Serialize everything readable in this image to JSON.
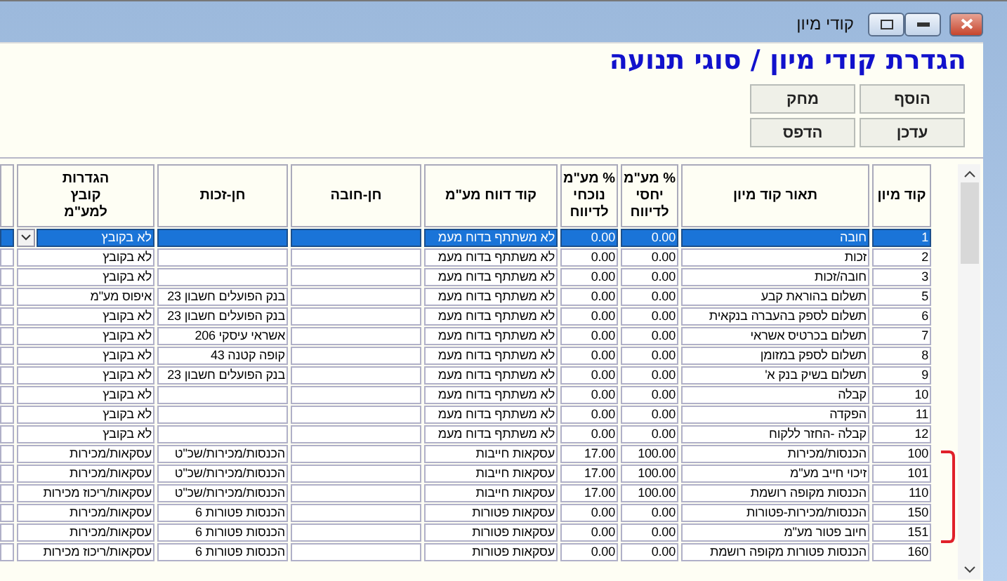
{
  "window": {
    "title": "קודי מיון"
  },
  "heading": "הגדרת קודי מיון / סוגי תנועה",
  "buttons": [
    {
      "label": "הוסף"
    },
    {
      "label": "מחק"
    },
    {
      "label": "עדכן"
    },
    {
      "label": "הדפס"
    }
  ],
  "table": {
    "columns": [
      "קוד מיון",
      "תאור קוד מיון",
      "% מע\"מ\nיחסי\nלדיווח",
      "% מע\"מ\nנוכחי\nלדיווח",
      "קוד דווח מע\"מ",
      "חן-חובה",
      "חן-זכות",
      "הגדרות\nקובץ\nלמע\"מ"
    ],
    "rows": [
      {
        "selected": true,
        "cells": [
          "1",
          "חובה",
          "0.00",
          "0.00",
          "לא משתתף בדוח מעמ",
          "",
          "",
          "לא בקובץ"
        ]
      },
      {
        "selected": false,
        "cells": [
          "2",
          "זכות",
          "0.00",
          "0.00",
          "לא משתתף בדוח מעמ",
          "",
          "",
          "לא בקובץ"
        ]
      },
      {
        "selected": false,
        "cells": [
          "3",
          "חובה/זכות",
          "0.00",
          "0.00",
          "לא משתתף בדוח מעמ",
          "",
          "",
          "לא בקובץ"
        ]
      },
      {
        "selected": false,
        "cells": [
          "5",
          "תשלום בהוראת קבע",
          "0.00",
          "0.00",
          "לא משתתף בדוח מעמ",
          "",
          "בנק הפועלים חשבון 23",
          "איפוס מע\"מ"
        ]
      },
      {
        "selected": false,
        "cells": [
          "6",
          "תשלום לספק בהעברה בנקאית",
          "0.00",
          "0.00",
          "לא משתתף בדוח מעמ",
          "",
          "בנק הפועלים חשבון 23",
          "לא בקובץ"
        ]
      },
      {
        "selected": false,
        "cells": [
          "7",
          "תשלום בכרטיס אשראי",
          "0.00",
          "0.00",
          "לא משתתף בדוח מעמ",
          "",
          "אשראי עיסקי  206",
          "לא בקובץ"
        ]
      },
      {
        "selected": false,
        "cells": [
          "8",
          "תשלום לספק במזומן",
          "0.00",
          "0.00",
          "לא משתתף בדוח מעמ",
          "",
          "קופה קטנה  43",
          "לא בקובץ"
        ]
      },
      {
        "selected": false,
        "cells": [
          "9",
          "תשלום בשיק בנק א'",
          "0.00",
          "0.00",
          "לא משתתף בדוח מעמ",
          "",
          "בנק הפועלים חשבון 23",
          "לא בקובץ"
        ]
      },
      {
        "selected": false,
        "cells": [
          "10",
          "קבלה",
          "0.00",
          "0.00",
          "לא משתתף בדוח מעמ",
          "",
          "",
          "לא בקובץ"
        ]
      },
      {
        "selected": false,
        "cells": [
          "11",
          "הפקדה",
          "0.00",
          "0.00",
          "לא משתתף בדוח מעמ",
          "",
          "",
          "לא בקובץ"
        ]
      },
      {
        "selected": false,
        "cells": [
          "12",
          "קבלה -החזר ללקוח",
          "0.00",
          "0.00",
          "לא משתתף בדוח מעמ",
          "",
          "",
          "לא בקובץ"
        ]
      },
      {
        "selected": false,
        "cells": [
          "100",
          "הכנסות/מכירות",
          "100.00",
          "17.00",
          "עסקאות חייבות",
          "",
          "הכנסות/מכירות/שכ\"ט",
          "עסקאות/מכירות"
        ]
      },
      {
        "selected": false,
        "cells": [
          "101",
          "זיכוי חייב מע\"מ",
          "100.00",
          "17.00",
          "עסקאות חייבות",
          "",
          "הכנסות/מכירות/שכ\"ט",
          "עסקאות/מכירות"
        ]
      },
      {
        "selected": false,
        "cells": [
          "110",
          "הכנסות מקופה רושמת",
          "100.00",
          "17.00",
          "עסקאות חייבות",
          "",
          "הכנסות/מכירות/שכ\"ט",
          "עסקאות/ריכוז מכירות"
        ]
      },
      {
        "selected": false,
        "cells": [
          "150",
          "הכנסות/מכירות-פטורות",
          "0.00",
          "0.00",
          "עסקאות פטורות",
          "",
          "הכנסות פטורות  6",
          "עסקאות/מכירות"
        ]
      },
      {
        "selected": false,
        "cells": [
          "151",
          "חיוב פטור מע\"מ",
          "0.00",
          "0.00",
          "עסקאות פטורות",
          "",
          "הכנסות פטורות  6",
          "עסקאות/מכירות"
        ]
      },
      {
        "selected": false,
        "cells": [
          "160",
          "הכנסות פטורות מקופה רושמת",
          "0.00",
          "0.00",
          "עסקאות פטורות",
          "",
          "הכנסות פטורות  6",
          "עסקאות/ריכוז מכירות"
        ]
      }
    ]
  }
}
